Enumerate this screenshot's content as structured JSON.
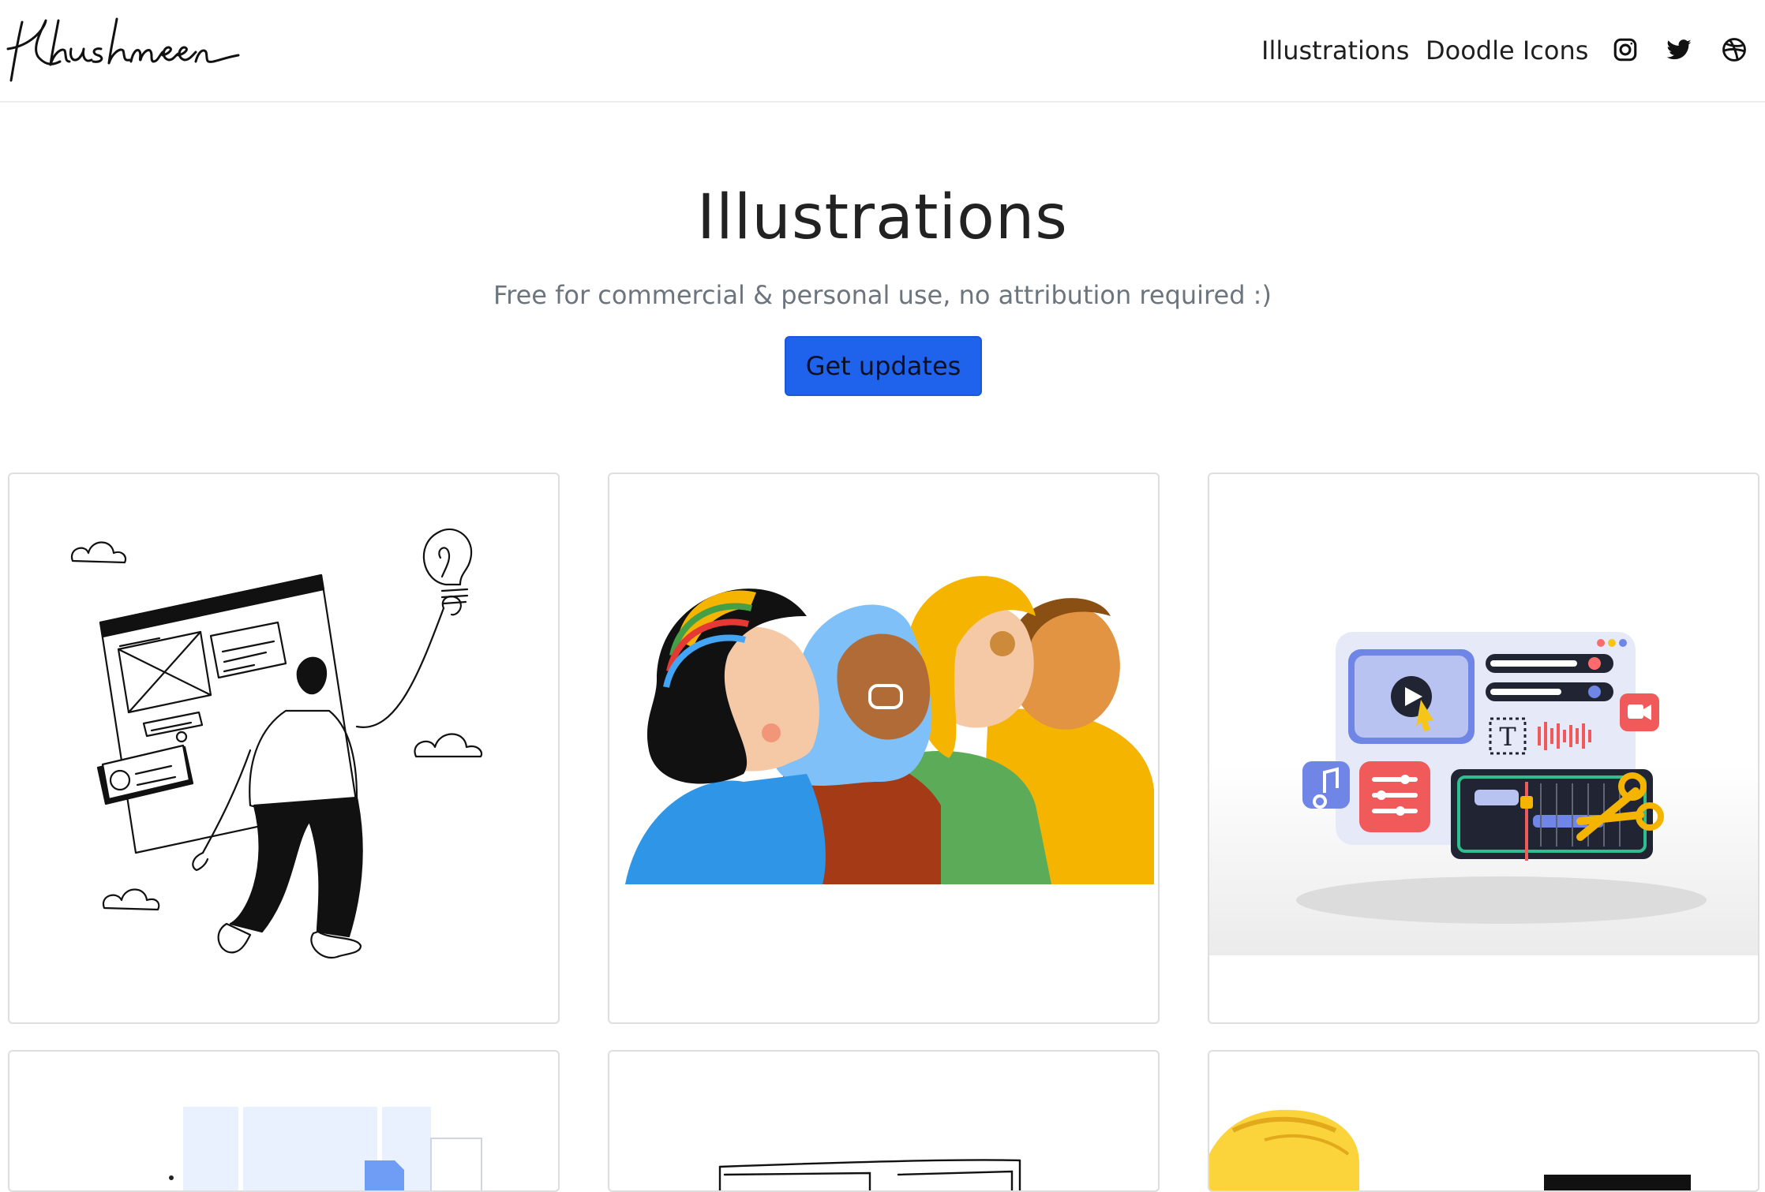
{
  "brand": {
    "logo_text": "Khushmeen"
  },
  "nav": {
    "links": [
      {
        "label": "Illustrations"
      },
      {
        "label": "Doodle Icons"
      }
    ],
    "social": [
      "instagram-icon",
      "twitter-icon",
      "dribbble-icon"
    ]
  },
  "hero": {
    "title": "Illustrations",
    "subtitle": "Free for commercial & personal use, no attribution required :)",
    "cta_label": "Get updates"
  },
  "colors": {
    "primary": "#1f63ed",
    "card_border": "#dedede",
    "text": "#212529",
    "muted": "#6c757d"
  },
  "gallery": {
    "cards": [
      {
        "subject": "doodle-person-lightbulb-wireframe"
      },
      {
        "subject": "diverse-women-profiles"
      },
      {
        "subject": "3d-video-editor-ui"
      },
      {
        "subject": "blue-documents"
      },
      {
        "subject": "sketch-browser-frame"
      },
      {
        "subject": "yellow-hand"
      }
    ]
  }
}
